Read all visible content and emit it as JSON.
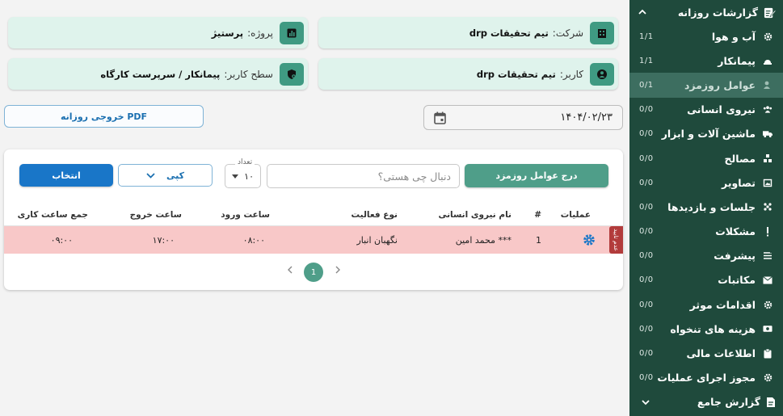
{
  "sidebar": {
    "header_title": "گزارشات روزانه",
    "items": [
      {
        "label": "آب و هوا",
        "count": "1/1",
        "icon": "gear-icon"
      },
      {
        "label": "پیمانکار",
        "count": "1/1",
        "icon": "helmet-icon"
      },
      {
        "label": "عوامل روزمزد",
        "count": "0/1",
        "icon": "worker-icon"
      },
      {
        "label": "نیروی انسانی",
        "count": "0/0",
        "icon": "people-icon"
      },
      {
        "label": "ماشین آلات و ابزار",
        "count": "0/0",
        "icon": "truck-icon"
      },
      {
        "label": "مصالح",
        "count": "0/0",
        "icon": "materials-icon"
      },
      {
        "label": "تصاویر",
        "count": "0/0",
        "icon": "image-icon"
      },
      {
        "label": "جلسات و بازدیدها",
        "count": "0/0",
        "icon": "meeting-icon"
      },
      {
        "label": "مشکلات",
        "count": "0/0",
        "icon": "exclamation-icon"
      },
      {
        "label": "پیشرفت",
        "count": "0/0",
        "icon": "checklist-icon"
      },
      {
        "label": "مکاتبات",
        "count": "0/0",
        "icon": "envelope-icon"
      },
      {
        "label": "اقدامات موثر",
        "count": "0/0",
        "icon": "settings-icon"
      },
      {
        "label": "هزینه های تنخواه",
        "count": "0/0",
        "icon": "money-icon"
      },
      {
        "label": "اطلاعات مالی",
        "count": "0/0",
        "icon": "clipboard-icon"
      },
      {
        "label": "مجوز اجرای عملیات",
        "count": "0/0",
        "icon": "gear-icon"
      }
    ],
    "footer_title": "گزارش جامع"
  },
  "cards": {
    "company_label": "شرکت:",
    "company_value": "تیم تحقیقات drp",
    "project_label": "پروژه:",
    "project_value": "پرستیژ",
    "user_label": "کاربر:",
    "user_value": "تیم تحقیقات drp",
    "level_label": "سطح کاربر:",
    "level_value": "پیمانکار / سرپرست کارگاه"
  },
  "toolbar": {
    "pdf_label": "خروجی روزانه PDF",
    "date_value": "۱۴۰۴/۰۲/۲۳"
  },
  "panel": {
    "insert_label": "درج عوامل روزمزد",
    "search_placeholder": "دنبال چی هستی؟",
    "count_label": "تعداد",
    "count_value": "۱۰",
    "copy_label": "کپی",
    "select_label": "انتخاب"
  },
  "table": {
    "headers": {
      "ops": "عملیات",
      "num": "#",
      "name": "نام نیروی انسانی",
      "activity": "نوع فعالیت",
      "in": "ساعت ورود",
      "out": "ساعت خروج",
      "total": "جمع ساعت کاری"
    },
    "row": {
      "status": "عدم تایید",
      "num": "1",
      "name": "محمد امین ***",
      "activity": "نگهبان انبار",
      "in": "۰۸:۰۰",
      "out": "۱۷:۰۰",
      "total": "۰۹:۰۰"
    }
  },
  "pagination": {
    "current": "1"
  },
  "colors": {
    "sidebar_bg": "#1f4a3c",
    "sidebar_active": "#3d6e60",
    "accent_green": "#4f9e89",
    "card_bg": "#dff3ec",
    "primary_blue": "#1976c8",
    "row_rejected": "#f8c8c8",
    "status_red": "#b23b3b"
  }
}
